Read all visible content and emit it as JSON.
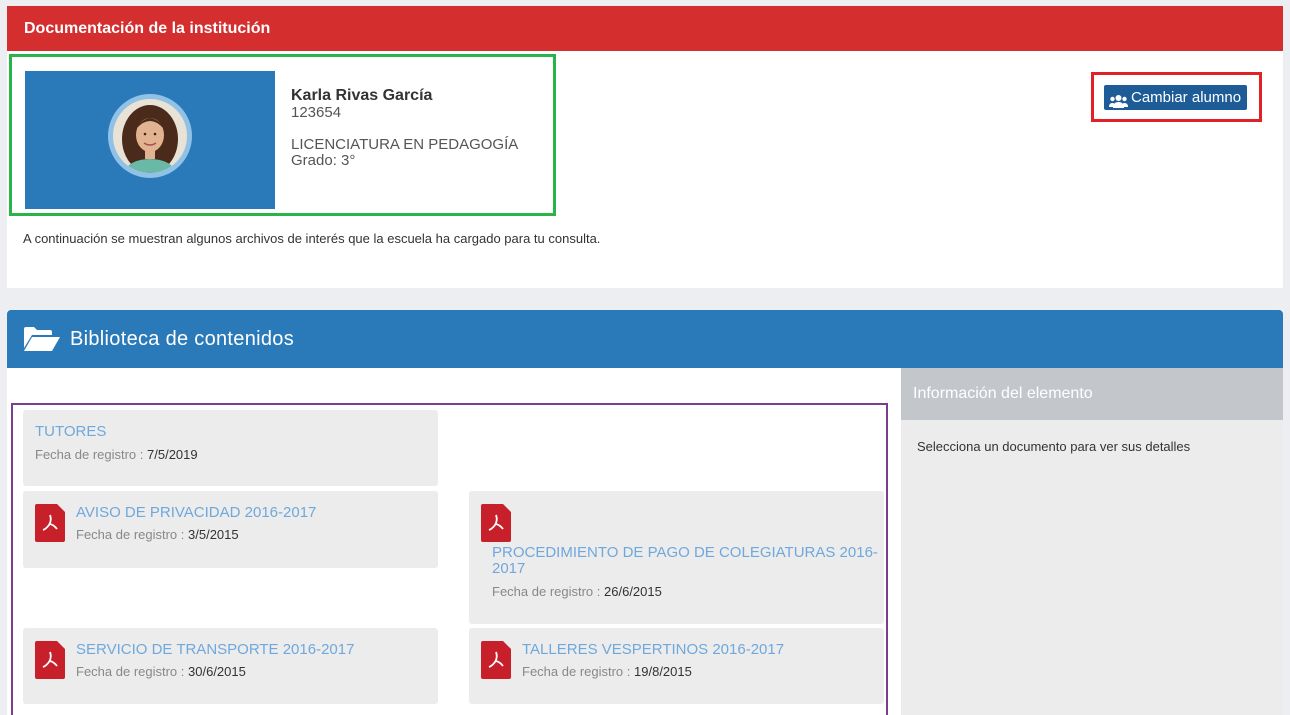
{
  "top_panel": {
    "title": "Documentación de la institución",
    "intro": "A continuación se muestran algunos archivos de interés que la escuela ha cargado para tu consulta."
  },
  "student": {
    "name": "Karla Rivas García",
    "id": "123654",
    "career": "LICENCIATURA EN PEDAGOGÍA",
    "grade": "Grado: 3°"
  },
  "change_button": {
    "label": "Cambiar alumno",
    "icon": "users-icon"
  },
  "library": {
    "title": "Biblioteca de contenidos",
    "icon": "folder-open-icon",
    "meta_label": "Fecha de registro :",
    "items": [
      {
        "title": "TUTORES",
        "date": "7/5/2019",
        "type": "folder"
      },
      {
        "title": "AVISO DE PRIVACIDAD 2016-2017",
        "date": "3/5/2015",
        "type": "pdf"
      },
      {
        "title": "PROCEDIMIENTO DE PAGO DE COLEGIATURAS 2016-",
        "title_line2": "2017",
        "date": "26/6/2015",
        "type": "pdf"
      },
      {
        "title": "SERVICIO DE TRANSPORTE 2016-2017",
        "date": "30/6/2015",
        "type": "pdf"
      },
      {
        "title": "TALLERES VESPERTINOS 2016-2017",
        "date": "19/8/2015",
        "type": "pdf"
      }
    ]
  },
  "info_panel": {
    "title": "Información del elemento",
    "body": "Selecciona un documento para ver sus detalles"
  },
  "colors": {
    "header_red": "#d42e2f",
    "library_blue": "#2a7ab9",
    "button_blue": "#1e5c98",
    "link_blue": "#6fa8dc",
    "pdf_red": "#c8202a",
    "highlight_green": "#28b44a",
    "highlight_red": "#e02227",
    "highlight_purple": "#7b3d8f"
  }
}
